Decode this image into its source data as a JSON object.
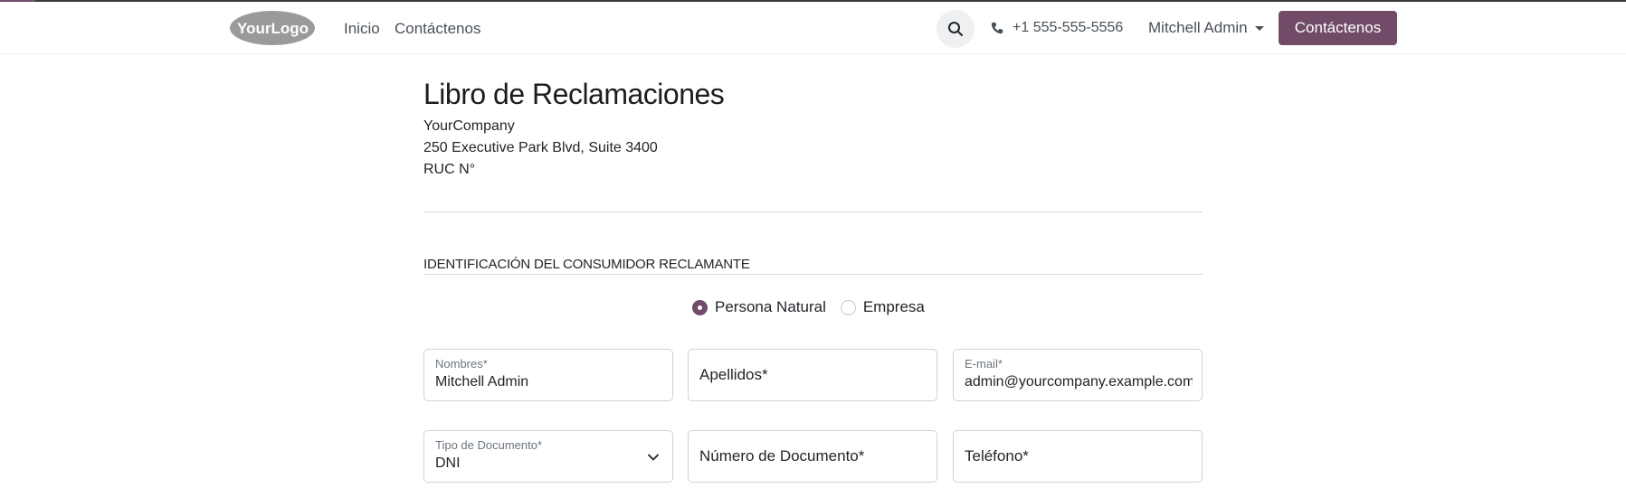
{
  "colors": {
    "brand": "#714b67",
    "text": "#212529",
    "muted": "#6c757d"
  },
  "header": {
    "logo_text": "YourLogo",
    "nav": [
      {
        "label": "Inicio"
      },
      {
        "label": "Contáctenos"
      }
    ],
    "search_icon": "search-icon",
    "phone_icon": "phone-icon",
    "phone": "+1 555-555-5556",
    "user": "Mitchell Admin",
    "cta_label": "Contáctenos"
  },
  "page": {
    "title": "Libro de Reclamaciones",
    "company": "YourCompany",
    "address": "250 Executive Park Blvd, Suite 3400",
    "ruc": "RUC N°",
    "section_title": "IDENTIFICACIÓN DEL CONSUMIDOR RECLAMANTE"
  },
  "person_type": {
    "options": [
      {
        "label": "Persona Natural",
        "checked": true
      },
      {
        "label": "Empresa",
        "checked": false
      }
    ]
  },
  "form": {
    "nombres": {
      "label": "Nombres*",
      "value": "Mitchell Admin"
    },
    "apellidos": {
      "placeholder": "Apellidos*"
    },
    "email": {
      "label": "E-mail*",
      "value": "admin@yourcompany.example.com"
    },
    "tipo_documento": {
      "label": "Tipo de Documento*",
      "value": "DNI"
    },
    "numero_documento": {
      "placeholder": "Número de Documento*"
    },
    "telefono": {
      "placeholder": "Teléfono*"
    }
  }
}
